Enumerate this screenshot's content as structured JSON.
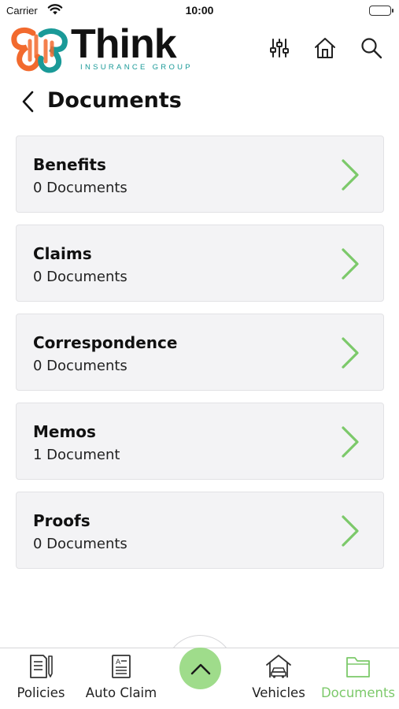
{
  "status_bar": {
    "carrier": "Carrier",
    "time": "10:00"
  },
  "header": {
    "logo_word": "Think",
    "logo_sub": "INSURANCE GROUP",
    "icons": [
      "filter-sliders-icon",
      "home-icon",
      "search-icon"
    ]
  },
  "page": {
    "title": "Documents"
  },
  "categories": [
    {
      "name": "Benefits",
      "count": "0 Documents"
    },
    {
      "name": "Claims",
      "count": "0 Documents"
    },
    {
      "name": "Correspondence",
      "count": "0 Documents"
    },
    {
      "name": "Memos",
      "count": "1 Document"
    },
    {
      "name": "Proofs",
      "count": "0 Documents"
    }
  ],
  "tab_bar": {
    "policies": "Policies",
    "auto_claim": "Auto Claim",
    "vehicles": "Vehicles",
    "documents": "Documents",
    "active": "documents"
  },
  "colors": {
    "accent_green": "#7cc96a",
    "center_button": "#9fdc8b",
    "card_bg": "#f3f3f5",
    "logo_orange": "#f26a2e",
    "logo_teal": "#1a9a98"
  }
}
